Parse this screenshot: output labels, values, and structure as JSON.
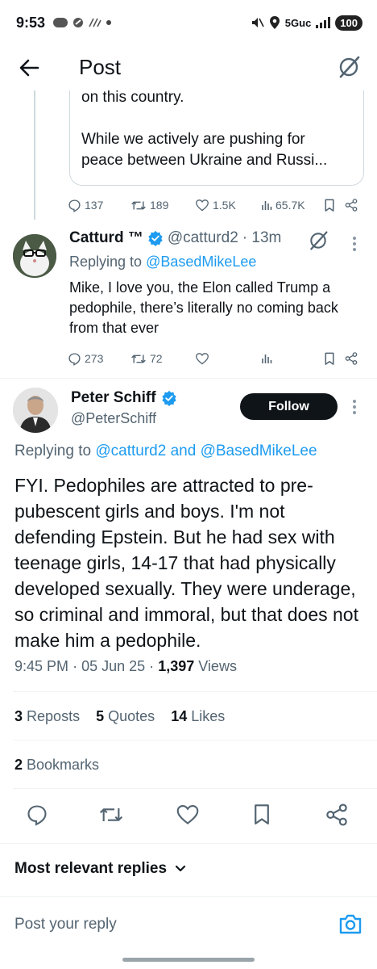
{
  "status_bar": {
    "time": "9:53",
    "network": "5Guc",
    "battery": "100"
  },
  "header": {
    "title": "Post"
  },
  "quoted_post": {
    "line1": "on this country.",
    "line2": "While we actively are pushing for",
    "line3": "peace between Ukraine and Russi..."
  },
  "prev_post_actions": {
    "replies": "137",
    "reposts": "189",
    "likes": "1.5K",
    "views": "65.7K"
  },
  "reply_post": {
    "name": "Catturd ™",
    "handle": "@catturd2",
    "time": "· 13m",
    "replying_prefix": "Replying to",
    "replying_to": "@BasedMikeLee",
    "text": "Mike, I love you, the Elon called Trump a pedophile, there’s literally no coming back from that ever",
    "replies": "273",
    "reposts": "72"
  },
  "main_post": {
    "name": "Peter Schiff",
    "handle": "@PeterSchiff",
    "follow_label": "Follow",
    "replying_prefix": "Replying to",
    "replying_to_1": "@catturd2",
    "replying_and": "and",
    "replying_to_2": "@BasedMikeLee",
    "text": "FYI. Pedophiles are attracted to pre-pubescent girls and boys.  I'm not defending Epstein. But he had sex with teenage girls, 14-17 that had physically developed sexually. They were underage, so criminal and immoral, but that does not make him a pedophile.",
    "time": "9:45 PM",
    "date": "05 Jun 25",
    "views_count": "1,397",
    "views_label": "Views",
    "reposts_count": "3",
    "reposts_label": "Reposts",
    "quotes_count": "5",
    "quotes_label": "Quotes",
    "likes_count": "14",
    "likes_label": "Likes",
    "bookmarks_count": "2",
    "bookmarks_label": "Bookmarks"
  },
  "replies_sort": {
    "label": "Most relevant replies"
  },
  "composer": {
    "placeholder": "Post your reply"
  },
  "colors": {
    "accent": "#1d9bf0",
    "text": "#0f1419",
    "secondary": "#536471",
    "border": "#eff3f4"
  }
}
